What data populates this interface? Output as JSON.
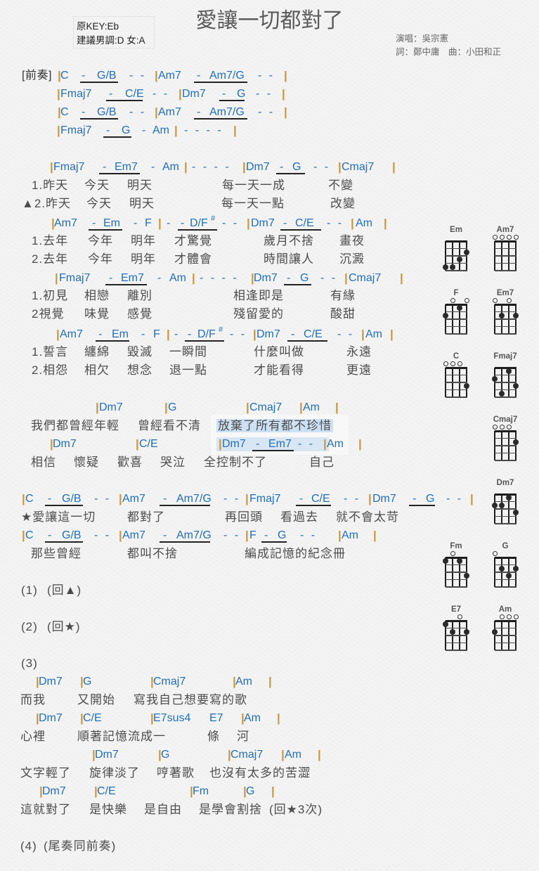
{
  "header": {
    "title": "愛讓一切都對了",
    "key_original": "原KEY:Eb",
    "key_suggested": "建議男調:D 女:A",
    "singer": "演唱：吳宗憲",
    "credits": "詞：鄭中庸　曲：小田和正"
  },
  "colors": {
    "chord": "#1f6fba",
    "bar": "#c8963e",
    "lyric": "#4d4d4d",
    "beam": "#222222",
    "highlight": "#a9cdf0"
  },
  "sheet": {
    "lines": [
      {
        "type": "chords",
        "tokens": [
          "[前奏]",
          "|",
          "C",
          "-",
          "G/B",
          "- -",
          "|",
          "Am7",
          "-",
          "Am7/G",
          "- -",
          "|"
        ]
      },
      {
        "type": "chords",
        "tokens": [
          "|",
          "Fmaj7",
          "-",
          "C/E",
          "- -",
          "|",
          "Dm7",
          "-",
          "G",
          "- -",
          "|"
        ]
      },
      {
        "type": "chords",
        "tokens": [
          "|",
          "C",
          "-",
          "G/B",
          "- -",
          "|",
          "Am7",
          "-",
          "Am7/G",
          "- -",
          "|"
        ]
      },
      {
        "type": "chords",
        "tokens": [
          "|",
          "Fmaj7",
          "-",
          "G",
          "-",
          "Am",
          "|",
          "- - - -",
          "|"
        ]
      },
      {
        "type": "chords",
        "tokens": [
          "|",
          "Fmaj7",
          "-",
          "Em7",
          "-",
          "Am",
          "|",
          "- - - -",
          "|",
          "Dm7",
          "-",
          "G",
          "- -",
          "|",
          "Cmaj7",
          "|"
        ]
      },
      {
        "type": "lyrics",
        "tokens": [
          "1.昨天",
          "今天",
          "明天",
          "每一天一成",
          "不變"
        ]
      },
      {
        "type": "lyrics",
        "tokens": [
          "▲2.昨天",
          "今天",
          "明天",
          "每一天一點",
          "改變"
        ]
      },
      {
        "type": "chords",
        "tokens": [
          "|",
          "Am7",
          "-",
          "Em",
          "-",
          "F",
          "|",
          "-",
          "-",
          "D/F",
          "#",
          "- -",
          "|",
          "Dm7",
          "-",
          "C/E",
          "- -",
          "|",
          "Am",
          "|"
        ]
      },
      {
        "type": "lyrics",
        "tokens": [
          "1.去年",
          "今年",
          "明年",
          "才驚覺",
          "歲月不捨",
          "畫夜"
        ]
      },
      {
        "type": "lyrics",
        "tokens": [
          "2.去年",
          "今年",
          "明年",
          "才體會",
          "時間讓人",
          "沉澱"
        ]
      },
      {
        "type": "chords",
        "tokens": [
          "|",
          "Fmaj7",
          "-",
          "Em7",
          "-",
          "Am",
          "|",
          "- - - -",
          "|",
          "Dm7",
          "-",
          "G",
          "- -",
          "|",
          "Cmaj7",
          "|"
        ]
      },
      {
        "type": "lyrics",
        "tokens": [
          "1.初見",
          "相戀",
          "離別",
          "相逢即是",
          "有緣"
        ]
      },
      {
        "type": "lyrics",
        "tokens": [
          "2視覺",
          "味覺",
          "感覺",
          "殘留愛的",
          "酸甜"
        ]
      },
      {
        "type": "chords",
        "tokens": [
          "|",
          "Am7",
          "-",
          "Em",
          "-",
          "F",
          "|",
          "-",
          "-",
          "D/F",
          "#",
          "- -",
          "|",
          "Dm7",
          "-",
          "C/E",
          "- -",
          "|",
          "Am",
          "|"
        ]
      },
      {
        "type": "lyrics",
        "tokens": [
          "1.誓言",
          "纏綿",
          "毀滅",
          "一瞬間",
          "什麼叫做",
          "永遠"
        ]
      },
      {
        "type": "lyrics",
        "tokens": [
          "2.相怨",
          "相欠",
          "想念",
          "退一點",
          "才能看得",
          "更遠"
        ]
      },
      {
        "type": "chords",
        "tokens": [
          "|",
          "Dm7",
          "|",
          "G",
          "|",
          "Cmaj7",
          "|",
          "Am",
          "|"
        ]
      },
      {
        "type": "lyrics",
        "tokens": [
          "我們都曾經年輕",
          "曾經看不清",
          "放棄了所有都不珍惜"
        ]
      },
      {
        "type": "chords",
        "tokens": [
          "|",
          "Dm7",
          "|",
          "C/E",
          "|",
          "Dm7",
          "-",
          "Em7",
          "- -",
          "|",
          "Am",
          "|"
        ]
      },
      {
        "type": "lyrics",
        "tokens": [
          "相信",
          "懷疑",
          "歡喜",
          "哭泣",
          "全控制不了",
          "自己"
        ]
      },
      {
        "type": "chords",
        "tokens": [
          "|",
          "C",
          "-",
          "G/B",
          "- -",
          "|",
          "Am7",
          "-",
          "Am7/G",
          "- -",
          "|",
          "Fmaj7",
          "-",
          "C/E",
          "- -",
          "|",
          "Dm7",
          "-",
          "G",
          "- -",
          "|"
        ]
      },
      {
        "type": "lyrics",
        "tokens": [
          "★愛讓這一切",
          "都對了",
          "再回頭",
          "看過去",
          "就不會太苛"
        ]
      },
      {
        "type": "chords",
        "tokens": [
          "|",
          "C",
          "-",
          "G/B",
          "- -",
          "|",
          "Am7",
          "-",
          "Am7/G",
          "- -",
          "|",
          "F",
          "-",
          "G",
          "- -",
          "|",
          "Am",
          "|"
        ]
      },
      {
        "type": "lyrics",
        "tokens": [
          "那些曾經",
          "都叫不捨",
          "編成記憶的紀念冊"
        ]
      },
      {
        "type": "lyrics",
        "tokens": [
          "(1)",
          "(回▲)"
        ]
      },
      {
        "type": "lyrics",
        "tokens": [
          "(2)",
          "(回★)"
        ]
      },
      {
        "type": "lyrics",
        "tokens": [
          "(3)"
        ]
      },
      {
        "type": "chords",
        "tokens": [
          "|",
          "Dm7",
          "|",
          "G",
          "|",
          "Cmaj7",
          "|",
          "Am",
          "|"
        ]
      },
      {
        "type": "lyrics",
        "tokens": [
          "而我",
          "又開始",
          "寫我自己想要寫的歌"
        ]
      },
      {
        "type": "chords",
        "tokens": [
          "|",
          "Dm7",
          "|",
          "C/E",
          "|",
          "E7sus4",
          "E7",
          "|",
          "Am",
          "|"
        ]
      },
      {
        "type": "lyrics",
        "tokens": [
          "心裡",
          "順著記憶流成一",
          "條",
          "河"
        ]
      },
      {
        "type": "chords",
        "tokens": [
          "|",
          "Dm7",
          "|",
          "G",
          "|",
          "Cmaj7",
          "|",
          "Am",
          "|"
        ]
      },
      {
        "type": "lyrics",
        "tokens": [
          "文字輕了",
          "旋律淡了",
          "哼著歌",
          "也沒有太多的苦澀"
        ]
      },
      {
        "type": "chords",
        "tokens": [
          "|",
          "Dm7",
          "|",
          "C/E",
          "|",
          "Fm",
          "|",
          "G",
          "|"
        ]
      },
      {
        "type": "lyrics",
        "tokens": [
          "這就對了",
          "是快樂",
          "是自由",
          "是學會割捨",
          "(回★3次)"
        ]
      },
      {
        "type": "lyrics",
        "tokens": [
          "(4)",
          "(尾奏同前奏)"
        ]
      }
    ]
  },
  "chord_diagrams": [
    {
      "name": "Em",
      "frets": [
        4,
        4,
        3,
        2
      ]
    },
    {
      "name": "Am7",
      "frets": [
        0,
        0,
        0,
        0
      ]
    },
    {
      "name": "F",
      "frets": [
        2,
        0,
        1,
        0
      ]
    },
    {
      "name": "Em7",
      "frets": [
        0,
        2,
        0,
        2
      ]
    },
    {
      "name": "C",
      "frets": [
        0,
        0,
        0,
        3
      ]
    },
    {
      "name": "Fmaj7",
      "frets": [
        2,
        4,
        1,
        3
      ]
    },
    {
      "name": "Cmaj7",
      "frets": [
        0,
        0,
        0,
        2
      ]
    },
    {
      "name": "Dm7",
      "frets": [
        2,
        2,
        1,
        3
      ]
    },
    {
      "name": "Fm",
      "frets": [
        1,
        0,
        1,
        3
      ]
    },
    {
      "name": "G",
      "frets": [
        0,
        2,
        3,
        2
      ]
    },
    {
      "name": "E7",
      "frets": [
        1,
        2,
        0,
        2
      ]
    },
    {
      "name": "Am",
      "frets": [
        2,
        0,
        0,
        0
      ]
    }
  ]
}
